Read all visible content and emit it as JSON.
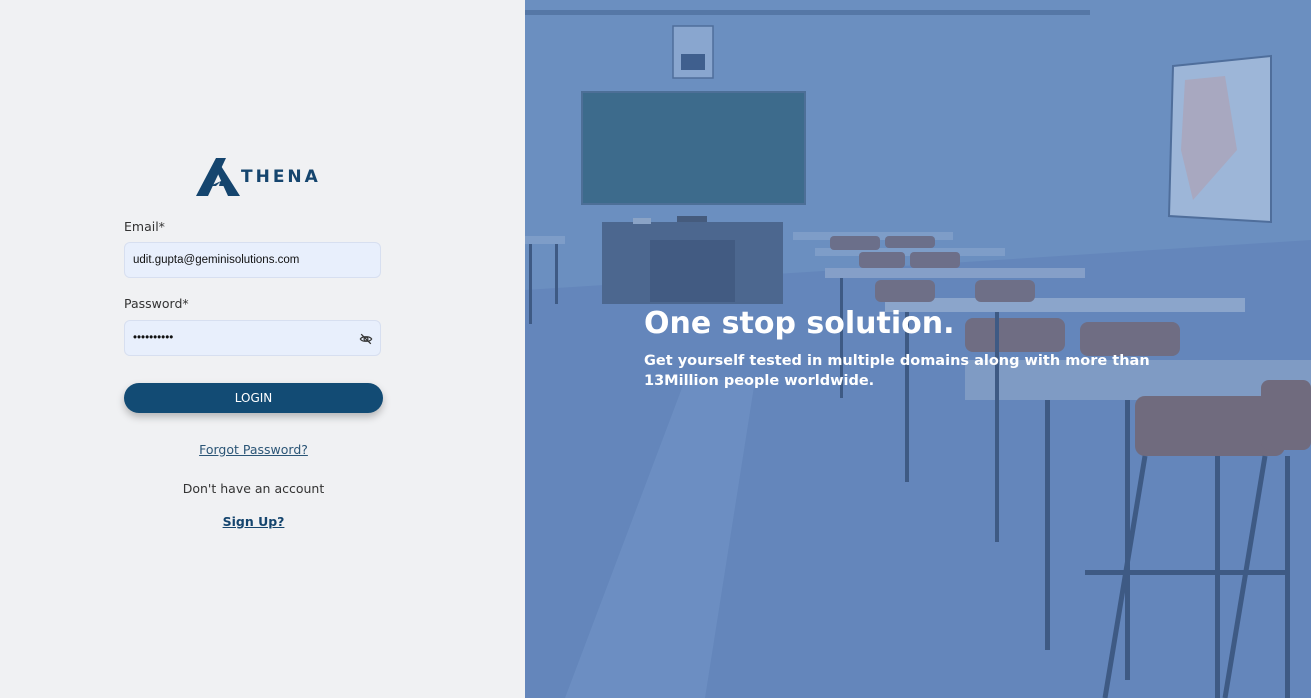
{
  "brand": {
    "logo_text": "THENA"
  },
  "login_form": {
    "email_label": "Email*",
    "email_value": "udit.gupta@geminisolutions.com",
    "password_label": "Password*",
    "password_value": "••••••••••",
    "login_button": "LOGIN",
    "forgot_password": "Forgot Password?",
    "no_account_text": "Don't have an account",
    "signup_link": "Sign Up?"
  },
  "hero": {
    "title": "One stop solution.",
    "subtitle": "Get yourself tested in multiple domains along with more than 13Million people worldwide."
  },
  "colors": {
    "primary": "#124b74",
    "left_bg": "#f0f1f3",
    "input_bg": "#e8effc",
    "hero_overlay": "#5a80b5"
  },
  "icons": {
    "password_toggle": "eye-slash-icon",
    "logo": "athena-logo-icon"
  }
}
